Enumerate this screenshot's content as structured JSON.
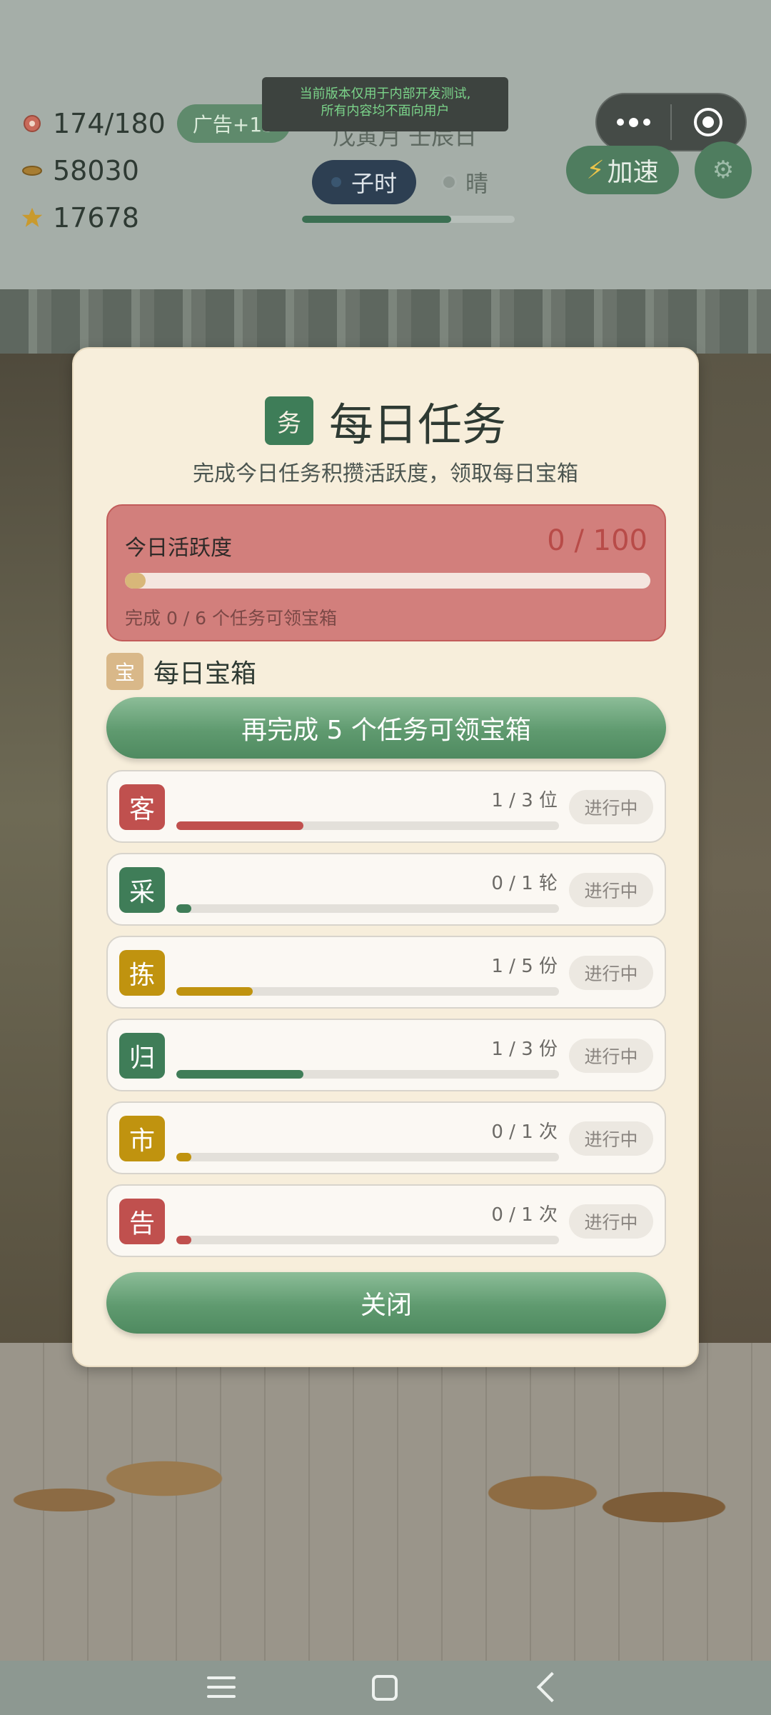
{
  "hud": {
    "stamina": "174/180",
    "ad_bonus": "广告+15",
    "coins": "58030",
    "stars": "17678"
  },
  "dev_banner": [
    "当前版本仅用于内部开发测试,",
    "所有内容均不面向用户"
  ],
  "calendar": {
    "date": "戊寅月 壬辰日",
    "time": "子时",
    "weather": "晴",
    "day_progress": 0.7
  },
  "controls": {
    "speed_label": "加速"
  },
  "modal": {
    "badge": "务",
    "title": "每日任务",
    "subtitle": "完成今日任务积攒活跃度，领取每日宝箱",
    "activity": {
      "label": "今日活跃度",
      "value": "0 / 100",
      "progress": 0.0,
      "hint": "完成 0 / 6 个任务可领宝箱"
    },
    "chest": {
      "badge": "宝",
      "title": "每日宝箱",
      "button": "再完成 5 个任务可领宝箱"
    },
    "tasks": [
      {
        "icon": "客",
        "color": "#c0504e",
        "count": "1 / 3 位",
        "progress": 0.333,
        "status": "进行中"
      },
      {
        "icon": "采",
        "color": "#3f7d58",
        "count": "0 / 1 轮",
        "progress": 0.0,
        "status": "进行中"
      },
      {
        "icon": "拣",
        "color": "#c0930f",
        "count": "1 / 5 份",
        "progress": 0.2,
        "status": "进行中"
      },
      {
        "icon": "归",
        "color": "#3f7d58",
        "count": "1 / 3 份",
        "progress": 0.333,
        "status": "进行中"
      },
      {
        "icon": "市",
        "color": "#c0930f",
        "count": "0 / 1 次",
        "progress": 0.0,
        "status": "进行中"
      },
      {
        "icon": "告",
        "color": "#c0504e",
        "count": "0 / 1 次",
        "progress": 0.0,
        "status": "进行中"
      }
    ],
    "close_button": "关闭"
  }
}
